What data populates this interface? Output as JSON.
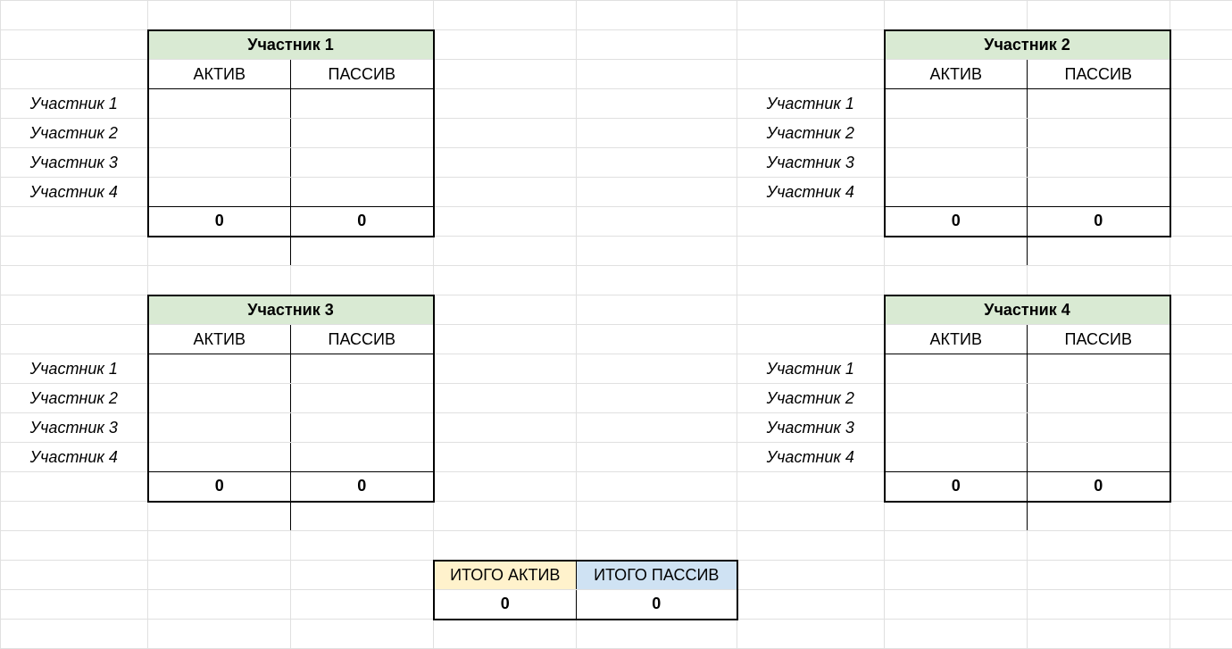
{
  "blocks": [
    {
      "title": "Участник 1",
      "col_asset": "АКТИВ",
      "col_liab": "ПАССИВ",
      "rows": [
        "Участник 1",
        "Участник 2",
        "Участник 3",
        "Участник 4"
      ],
      "sum_asset": "0",
      "sum_liab": "0"
    },
    {
      "title": "Участник 2",
      "col_asset": "АКТИВ",
      "col_liab": "ПАССИВ",
      "rows": [
        "Участник 1",
        "Участник 2",
        "Участник 3",
        "Участник 4"
      ],
      "sum_asset": "0",
      "sum_liab": "0"
    },
    {
      "title": "Участник 3",
      "col_asset": "АКТИВ",
      "col_liab": "ПАССИВ",
      "rows": [
        "Участник 1",
        "Участник 2",
        "Участник 3",
        "Участник 4"
      ],
      "sum_asset": "0",
      "sum_liab": "0"
    },
    {
      "title": "Участник 4",
      "col_asset": "АКТИВ",
      "col_liab": "ПАССИВ",
      "rows": [
        "Участник 1",
        "Участник 2",
        "Участник 3",
        "Участник 4"
      ],
      "sum_asset": "0",
      "sum_liab": "0"
    }
  ],
  "totals": {
    "label_asset": "ИТОГО АКТИВ",
    "label_liab": "ИТОГО ПАССИВ",
    "value_asset": "0",
    "value_liab": "0"
  }
}
